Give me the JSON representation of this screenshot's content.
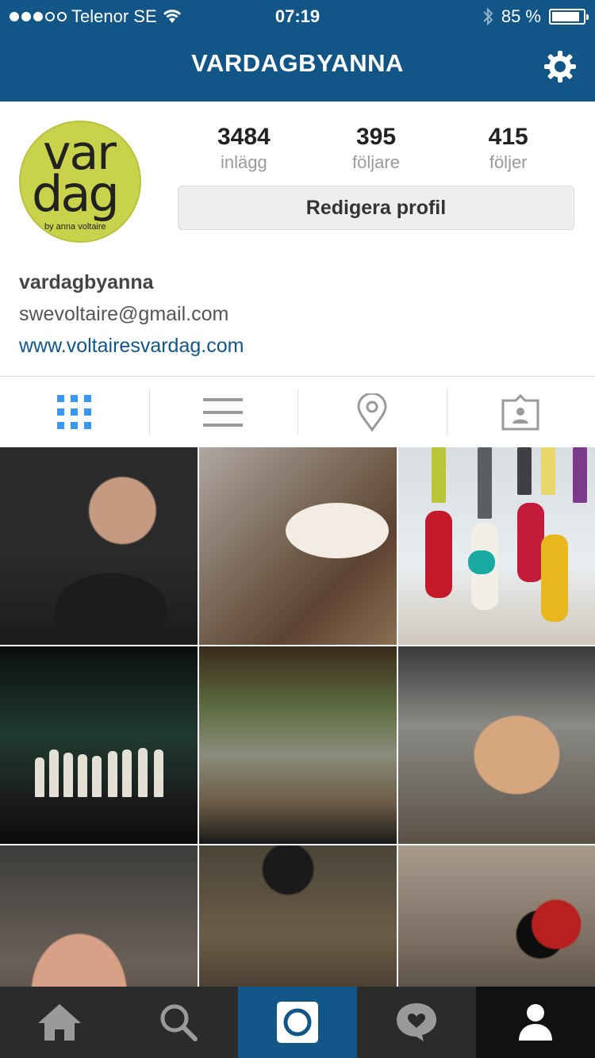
{
  "status_bar": {
    "carrier": "Telenor SE",
    "time": "07:19",
    "battery": "85 %"
  },
  "nav": {
    "title": "VARDAGBYANNA",
    "settings_icon": "gear-icon"
  },
  "profile": {
    "avatar_text": {
      "line1": "var",
      "line2": "dag",
      "line3": "by anna voltaire"
    },
    "stats": [
      {
        "value": "3484",
        "label": "inlägg"
      },
      {
        "value": "395",
        "label": "följare"
      },
      {
        "value": "415",
        "label": "följer"
      }
    ],
    "edit_button": "Redigera profil",
    "username": "vardagbyanna",
    "email": "swevoltaire@gmail.com",
    "website": "www.voltairesvardag.com"
  },
  "tabs": [
    {
      "icon": "grid-icon",
      "active": true
    },
    {
      "icon": "list-icon",
      "active": false
    },
    {
      "icon": "location-pin-icon",
      "active": false
    },
    {
      "icon": "tagged-photos-icon",
      "active": false
    }
  ],
  "bottom_nav": [
    {
      "icon": "home-icon"
    },
    {
      "icon": "search-icon"
    },
    {
      "icon": "camera-icon"
    },
    {
      "icon": "activity-heart-icon"
    },
    {
      "icon": "profile-icon"
    }
  ],
  "colors": {
    "brand": "#125688",
    "tab_active": "#3897f0",
    "tab_inactive": "#9a9a9a",
    "bottom_bar": "#2b2b2b"
  }
}
